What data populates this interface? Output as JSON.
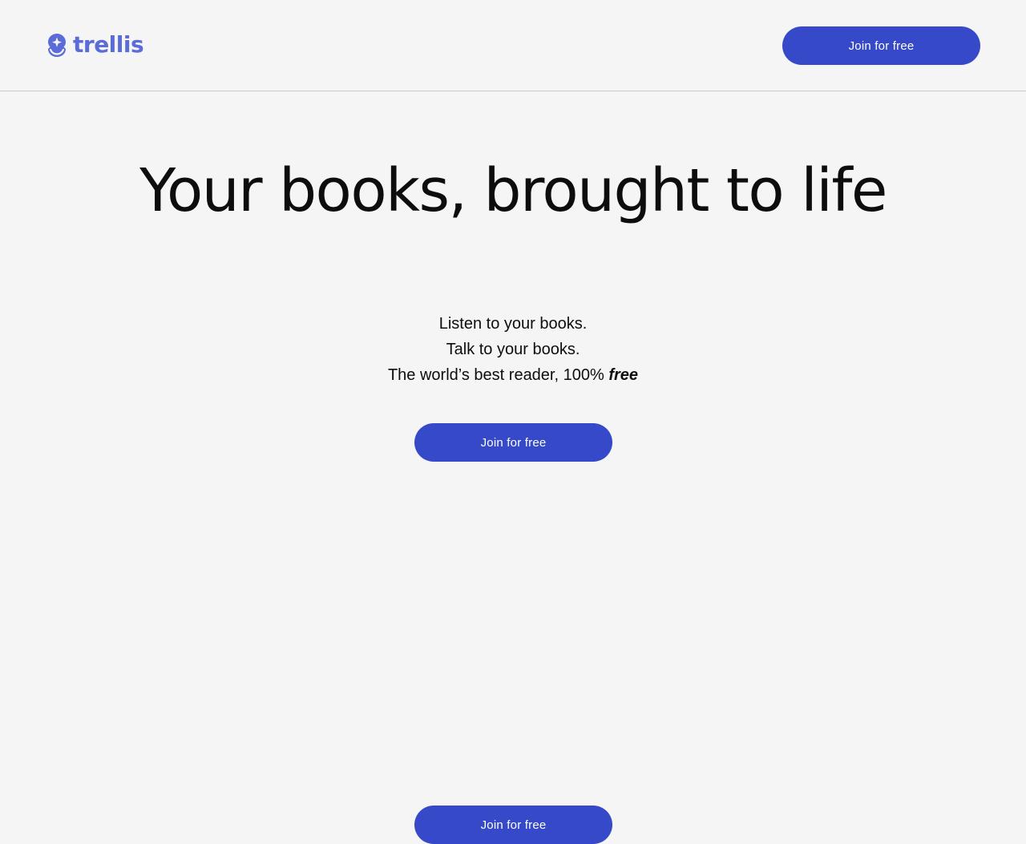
{
  "colors": {
    "brand": "#5b6bd8",
    "button": "#3549c9",
    "background": "#f5f5f5",
    "divider": "#c9c9c9",
    "text": "#0d0d0d"
  },
  "header": {
    "logo_icon": "trellis-logo-icon",
    "logo_text": "trellis",
    "cta_label": "Join for free"
  },
  "hero": {
    "title": "Your books, brought to life",
    "lines": [
      "Listen to your books.",
      "Talk to your books."
    ],
    "line3_prefix": "The world’s best reader, 100% ",
    "line3_emphasis": "free",
    "cta_label": "Join for free"
  },
  "bottom": {
    "cta_label": "Join for free"
  }
}
